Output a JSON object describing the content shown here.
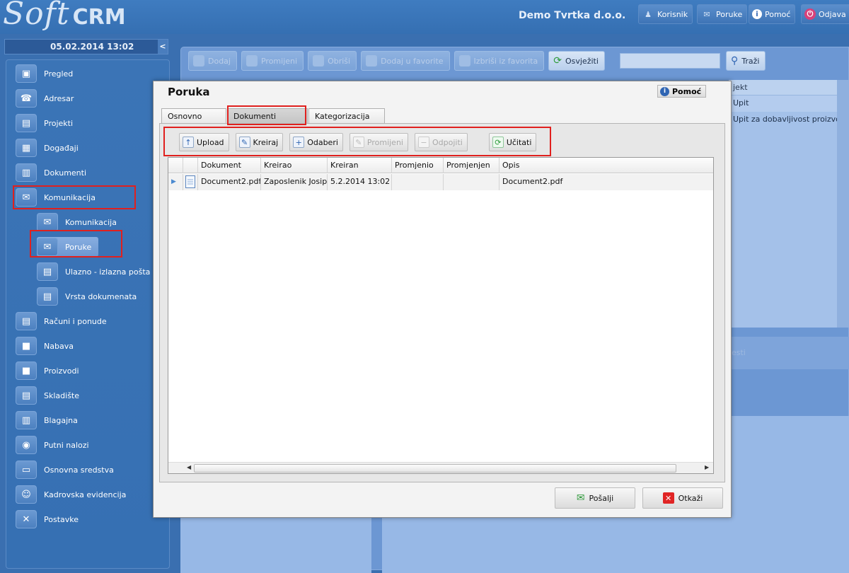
{
  "app": {
    "logo_soft": "Soft",
    "logo_crm": "CRM",
    "company": "Demo Tvrtka d.o.o."
  },
  "topbar": {
    "user": "Korisnik",
    "messages": "Poruke",
    "help": "Pomoć",
    "logout": "Odjava"
  },
  "sidebar": {
    "datetime": "05.02.2014 13:02",
    "collapse": "<",
    "items": [
      {
        "label": "Pregled",
        "icon": "overview-icon",
        "glyph": "▣"
      },
      {
        "label": "Adresar",
        "icon": "address-book-icon",
        "glyph": "☎"
      },
      {
        "label": "Projekti",
        "icon": "projects-icon",
        "glyph": "▤"
      },
      {
        "label": "Događaji",
        "icon": "calendar-icon",
        "glyph": "▦"
      },
      {
        "label": "Dokumenti",
        "icon": "documents-icon",
        "glyph": "▥"
      },
      {
        "label": "Komunikacija",
        "icon": "communication-icon",
        "glyph": "✉"
      },
      {
        "label": "Komunikacija",
        "icon": "mail-icon",
        "glyph": "✉"
      },
      {
        "label": "Poruke",
        "icon": "message-icon",
        "glyph": "✉"
      },
      {
        "label": "Ulazno - izlazna pošta",
        "icon": "inbox-icon",
        "glyph": "▤"
      },
      {
        "label": "Vrsta dokumenata",
        "icon": "doc-type-icon",
        "glyph": "▤"
      },
      {
        "label": "Računi i ponude",
        "icon": "invoice-icon",
        "glyph": "▤"
      },
      {
        "label": "Nabava",
        "icon": "purchase-icon",
        "glyph": "■"
      },
      {
        "label": "Proizvodi",
        "icon": "products-icon",
        "glyph": "■"
      },
      {
        "label": "Skladište",
        "icon": "warehouse-icon",
        "glyph": "▤"
      },
      {
        "label": "Blagajna",
        "icon": "cashbox-icon",
        "glyph": "▥"
      },
      {
        "label": "Putni nalozi",
        "icon": "travel-icon",
        "glyph": "◉"
      },
      {
        "label": "Osnovna sredstva",
        "icon": "assets-icon",
        "glyph": "▭"
      },
      {
        "label": "Kadrovska evidencija",
        "icon": "hr-icon",
        "glyph": "☺"
      },
      {
        "label": "Postavke",
        "icon": "settings-icon",
        "glyph": "✕"
      }
    ]
  },
  "main_toolbar": {
    "add": "Dodaj",
    "edit": "Promijeni",
    "delete": "Obriši",
    "add_fav": "Dodaj u favorite",
    "remove_fav": "Izbriši iz favorita",
    "refresh": "Osvježiti",
    "search_value": "",
    "search": "Traži"
  },
  "right_list": {
    "header": "jekt",
    "rows": [
      "Upit",
      "Upit za dobavljivost proizvoda"
    ],
    "strip": "esti"
  },
  "dialog": {
    "title": "Poruka",
    "help": "Pomoć",
    "tabs": [
      "Osnovno",
      "Dokumenti",
      "Kategorizacija"
    ],
    "toolbar": {
      "upload": "Upload",
      "create": "Kreiraj",
      "select": "Odaberi",
      "change": "Promijeni",
      "detach": "Odpojiti",
      "load": "Učitati"
    },
    "grid": {
      "columns": [
        "Dokument",
        "Kreirao",
        "Kreiran",
        "Promjenio",
        "Promjenjen",
        "Opis"
      ],
      "rows": [
        {
          "document": "Document2.pdf",
          "created_by": "Zaposlenik Josip",
          "created": "5.2.2014 13:02",
          "changed_by": "",
          "changed": "",
          "description": "Document2.pdf"
        }
      ]
    },
    "send": "Pošalji",
    "cancel": "Otkaži"
  }
}
